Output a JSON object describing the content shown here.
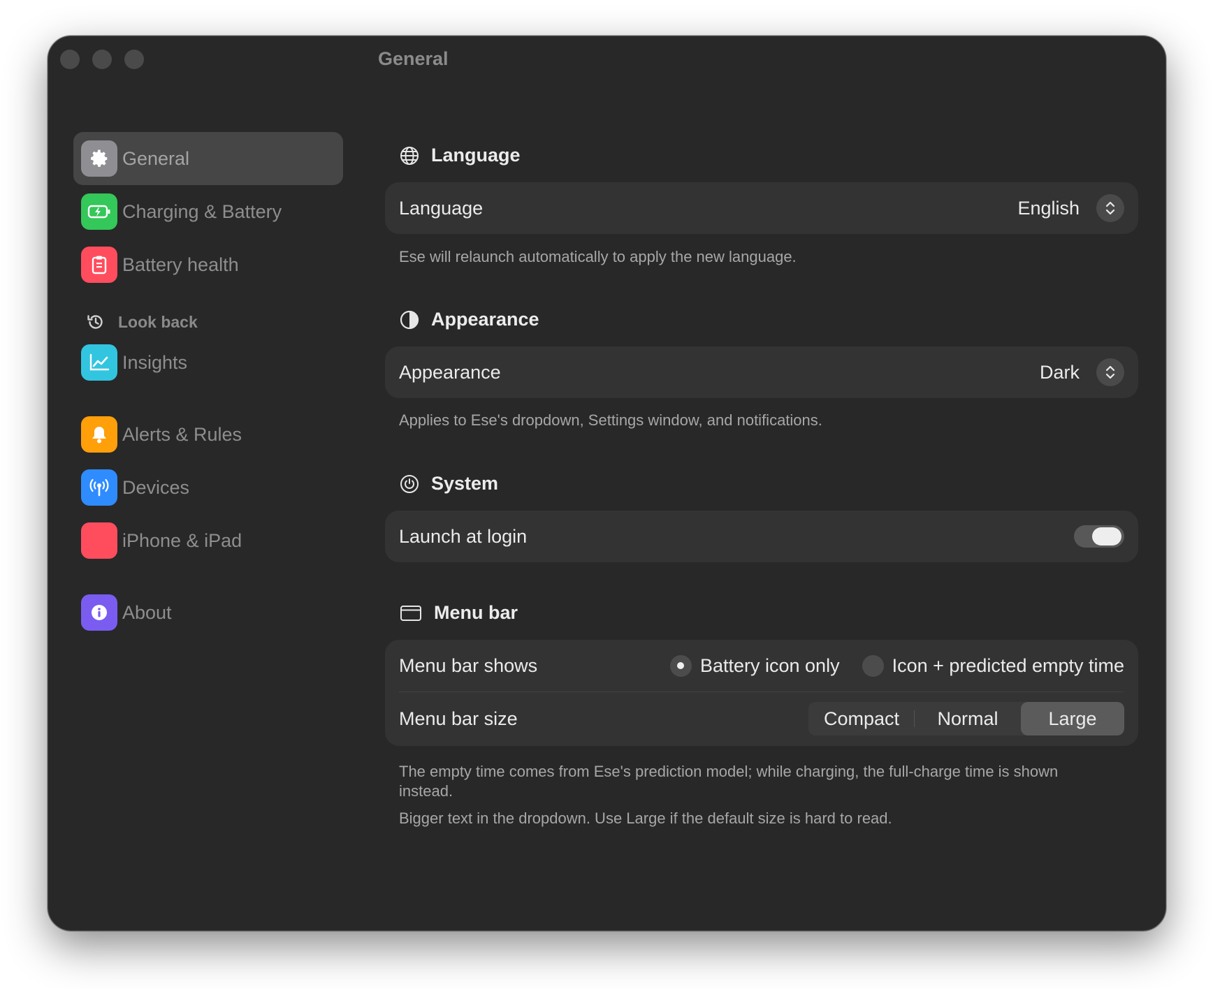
{
  "window": {
    "title": "General"
  },
  "sidebar": {
    "items": [
      {
        "label": "General",
        "icon": "gear-icon",
        "color": "#8e8e93",
        "active": true
      },
      {
        "label": "Charging & Battery",
        "icon": "battery-charging-icon",
        "color": "#34c759"
      },
      {
        "label": "Battery health",
        "icon": "clipboard-icon",
        "color": "#ff4d5e"
      },
      {
        "label": "Insights",
        "icon": "chart-icon",
        "color": "#32c5e0"
      },
      {
        "label": "Alerts & Rules",
        "icon": "bell-icon",
        "color": "#ff9f0a"
      },
      {
        "label": "Devices",
        "icon": "antenna-icon",
        "color": "#2f8cff"
      },
      {
        "label": "iPhone & iPad",
        "icon": "device-icon",
        "color": "#ff4d5e"
      },
      {
        "label": "About",
        "icon": "info-icon",
        "color": "#7a5cf0"
      }
    ],
    "section_lookback": {
      "label": "Look back",
      "icon": "history-icon"
    }
  },
  "language": {
    "heading": "Language",
    "row_label": "Language",
    "value": "English",
    "description": "Ese will relaunch automatically to apply the new language."
  },
  "appearance": {
    "heading": "Appearance",
    "row_label": "Appearance",
    "value": "Dark",
    "description": "Applies to Ese's dropdown, Settings window, and notifications."
  },
  "system": {
    "heading": "System",
    "launch_label": "Launch at login",
    "launch_enabled": true
  },
  "menubar": {
    "heading": "Menu bar",
    "shows_label": "Menu bar shows",
    "options": [
      {
        "label": "Battery icon only",
        "selected": true
      },
      {
        "label": "Icon + predicted empty time",
        "selected": false
      }
    ],
    "size_label": "Menu bar size",
    "sizes": [
      {
        "label": "Compact",
        "selected": false
      },
      {
        "label": "Normal",
        "selected": false
      },
      {
        "label": "Large",
        "selected": true
      }
    ],
    "description_1": "The empty time comes from Ese's prediction model; while charging, the full-charge time is shown instead.",
    "description_2": "Bigger text in the dropdown. Use Large if the default size is hard to read."
  }
}
